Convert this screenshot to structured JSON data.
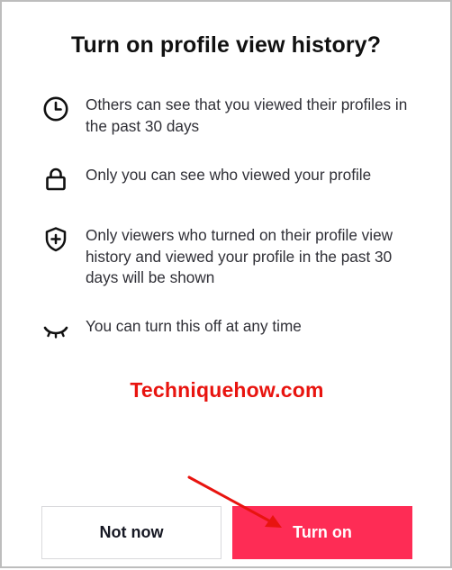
{
  "dialog": {
    "title": "Turn on profile view history?",
    "items": [
      {
        "icon": "clock-icon",
        "text": "Others can see that you viewed their profiles in the past 30 days"
      },
      {
        "icon": "lock-icon",
        "text": "Only you can see who viewed your profile"
      },
      {
        "icon": "shield-plus-icon",
        "text": "Only viewers who turned on their profile view history and viewed your profile in the past 30 days will be shown"
      },
      {
        "icon": "closed-eye-icon",
        "text": "You can turn this off at any time"
      }
    ],
    "buttons": {
      "secondary_label": "Not now",
      "primary_label": "Turn on"
    }
  },
  "watermark": {
    "text": "Techniquehow.com",
    "color": "#e8140f"
  },
  "annotation": {
    "type": "arrow",
    "color": "#e8140f",
    "points_to": "turn-on-button"
  },
  "colors": {
    "primary": "#fe2c55",
    "text": "#161823",
    "border": "#bdbdbd"
  }
}
